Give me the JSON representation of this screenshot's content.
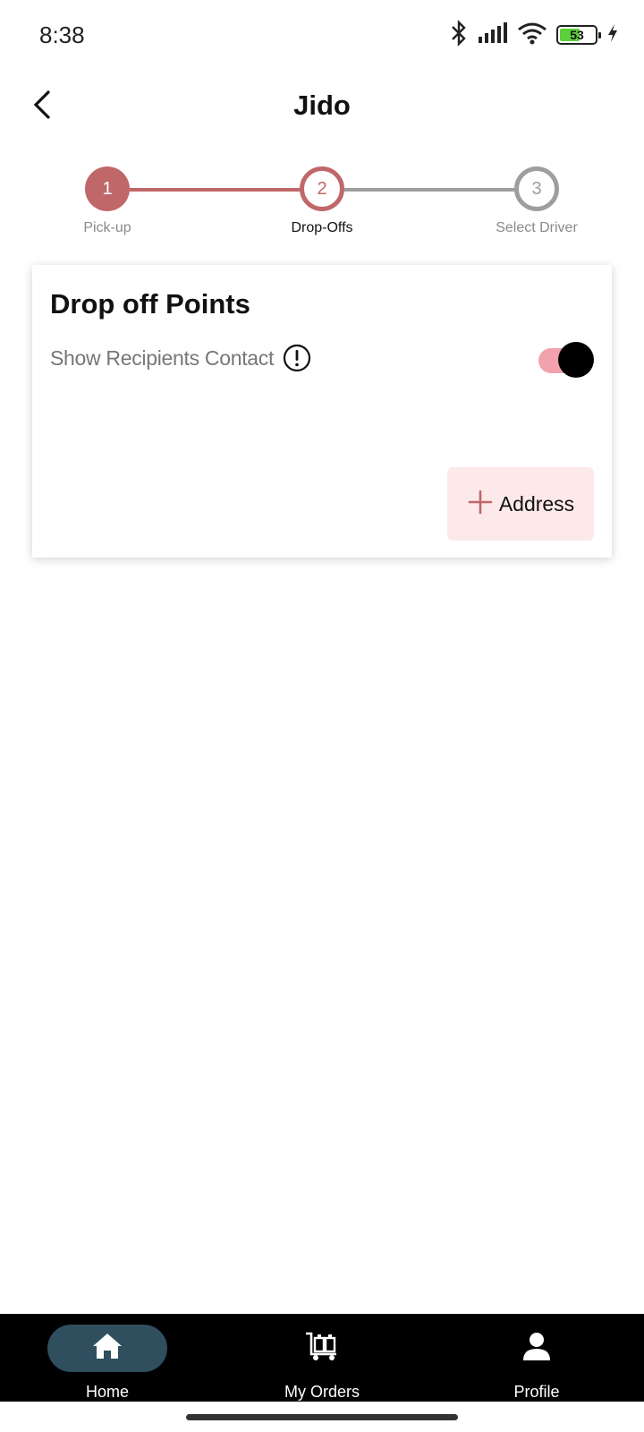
{
  "status_bar": {
    "time": "8:38",
    "battery_level": "53",
    "battery_fraction": 0.53,
    "icons": [
      "bluetooth-icon",
      "signal-icon",
      "wifi-icon",
      "battery-icon",
      "charging-icon"
    ]
  },
  "header": {
    "title": "Jido",
    "back_icon": "chevron-left-icon"
  },
  "stepper": {
    "steps": [
      {
        "number": "1",
        "label": "Pick-up",
        "state": "completed"
      },
      {
        "number": "2",
        "label": "Drop-Offs",
        "state": "current"
      },
      {
        "number": "3",
        "label": "Select Driver",
        "state": "pending"
      }
    ]
  },
  "card": {
    "title": "Drop off Points",
    "contact_label": "Show Recipients Contact",
    "toggle_on": true,
    "add_address_label": "Address"
  },
  "bottom_nav": {
    "items": [
      {
        "label": "Home",
        "icon": "home-icon",
        "active": true
      },
      {
        "label": "My Orders",
        "icon": "luggage-cart-icon",
        "active": false
      },
      {
        "label": "Profile",
        "icon": "user-icon",
        "active": false
      }
    ]
  },
  "colors": {
    "accent": "#c0676a",
    "inactive": "#9e9e9e",
    "toggle_track": "#f2a2ad",
    "nav_active_pill": "#2f4f5f"
  }
}
